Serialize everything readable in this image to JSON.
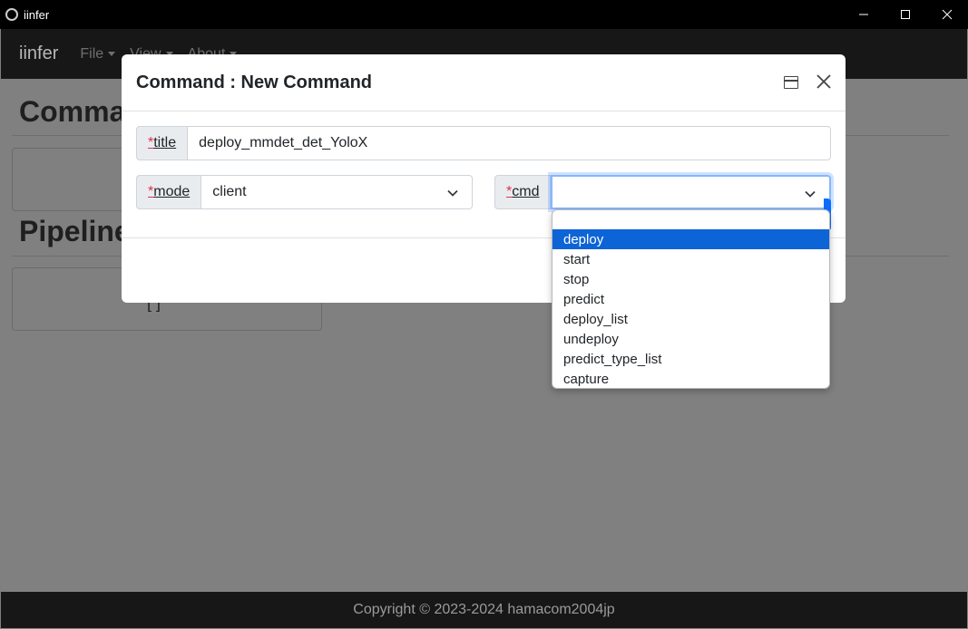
{
  "window": {
    "title": "iinfer"
  },
  "navbar": {
    "brand": "iinfer",
    "menus": [
      "File",
      "View",
      "About"
    ]
  },
  "page": {
    "sections": [
      {
        "title": "Commands"
      },
      {
        "title": "Pipelines"
      }
    ],
    "card_text": "[ ]"
  },
  "footer": {
    "text": "Copyright © 2023-2024 hamacom2004jp"
  },
  "modal": {
    "title": "Command : New Command",
    "fields": {
      "title": {
        "required_mark": "*",
        "label": "title",
        "value": "deploy_mmdet_det_YoloX"
      },
      "mode": {
        "required_mark": "*",
        "label": "mode",
        "value": "client"
      },
      "cmd": {
        "required_mark": "*",
        "label": "cmd",
        "value": ""
      }
    }
  },
  "cmd_dropdown": {
    "options": [
      "deploy",
      "start",
      "stop",
      "predict",
      "deploy_list",
      "undeploy",
      "predict_type_list",
      "capture"
    ],
    "highlighted": "deploy"
  },
  "colors": {
    "accent": "#0d64d6",
    "required": "#dc3545",
    "focus_ring": "#86b7fe"
  }
}
